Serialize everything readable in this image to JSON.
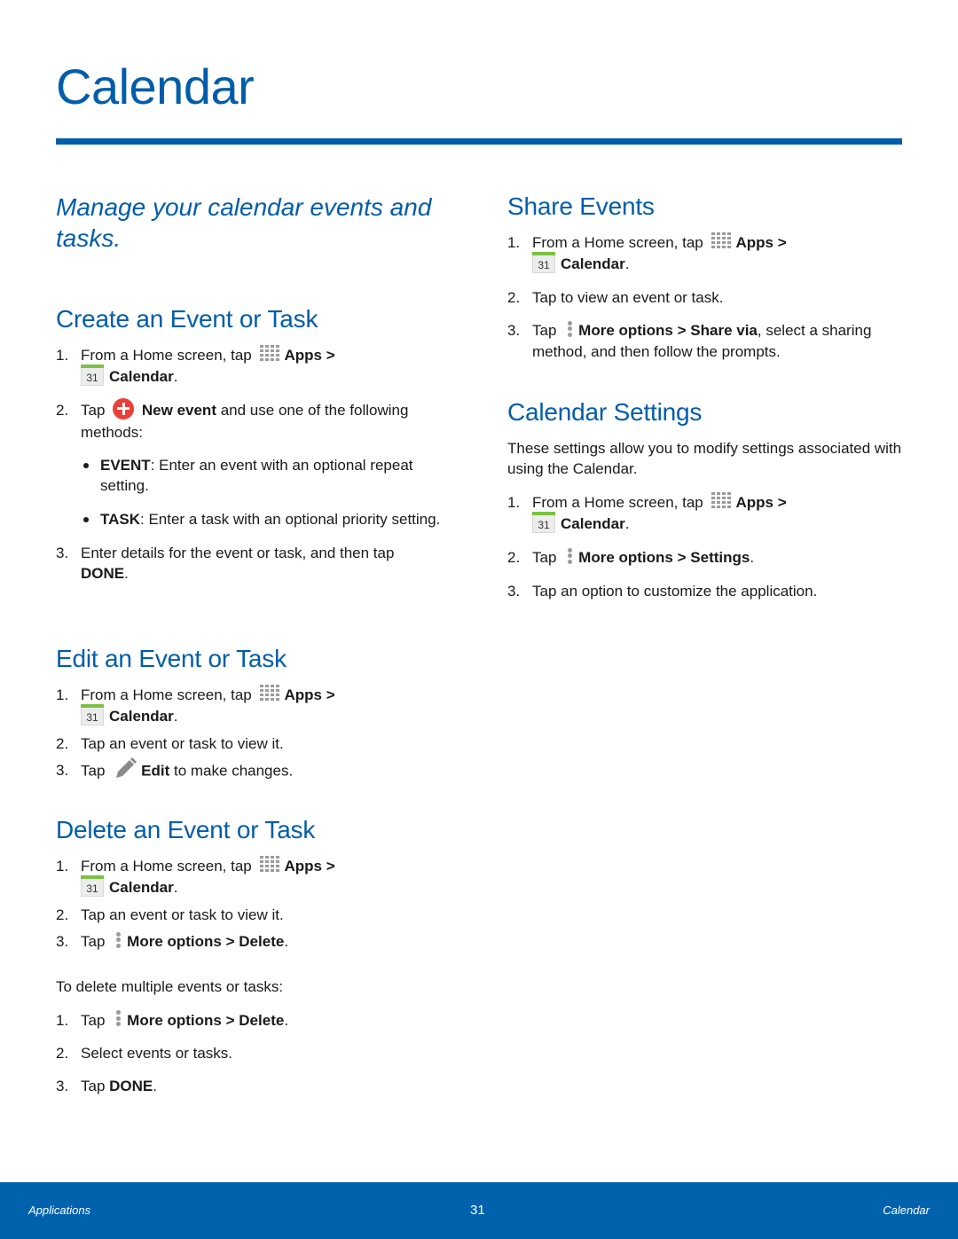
{
  "page": {
    "title": "Calendar",
    "intro": "Manage your calendar events and tasks.",
    "accent_color": "#005daa"
  },
  "common": {
    "home_prefix": "From a Home screen, tap",
    "apps_label": "Apps",
    "gt": ">",
    "calendar_label": "Calendar",
    "period": ".",
    "tap": "Tap",
    "more_options": "More options",
    "icons": {
      "apps": "apps-grid-icon",
      "calendar": "calendar-31-icon",
      "calendar_day": "31",
      "new_event": "plus-circle-icon",
      "more": "more-options-vertical-dots-icon",
      "edit": "pencil-edit-icon"
    }
  },
  "sections": {
    "create": {
      "heading": "Create an Event or Task",
      "step2_new_event": "New event",
      "step2_rest": "and use one of the following methods:",
      "bullets": [
        {
          "term": "EVENT",
          "text": ": Enter an event with an optional repeat setting."
        },
        {
          "term": "TASK",
          "text": ": Enter a task with an optional priority setting."
        }
      ],
      "step3_text": "Enter details for the event or task, and then tap",
      "step3_done": "DONE"
    },
    "edit": {
      "heading": "Edit an Event or Task",
      "step2": "Tap an event or task to view it.",
      "step3_edit": "Edit",
      "step3_rest": "to make changes."
    },
    "delete": {
      "heading": "Delete an Event or Task",
      "step2": "Tap an event or task to view it.",
      "delete_label": "Delete",
      "multi_intro": "To delete multiple events or tasks:",
      "multi_step2": "Select events or tasks.",
      "multi_step3_done": "DONE"
    },
    "share": {
      "heading": "Share Events",
      "step2": "Tap to view an event or task.",
      "share_via": "Share via",
      "step3_rest": ", select a sharing method, and then follow the prompts."
    },
    "settings": {
      "heading": "Calendar Settings",
      "intro": "These settings allow you to modify settings associated with using the Calendar.",
      "settings_label": "Settings",
      "step3": "Tap an option to customize the application."
    }
  },
  "numbers": [
    "1.",
    "2.",
    "3."
  ],
  "footer": {
    "left": "Applications",
    "page_number": "31",
    "right": "Calendar",
    "background": "#0061ad"
  }
}
